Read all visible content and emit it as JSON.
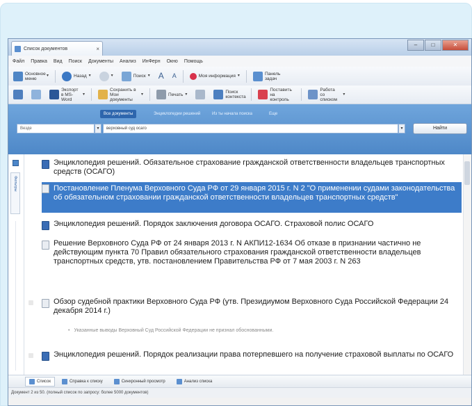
{
  "window": {
    "tab_title": "Список документов",
    "tab_close": "×"
  },
  "menu": [
    "Файл",
    "Правка",
    "Вид",
    "Поиск",
    "Документы",
    "Анализ",
    "ИнФерн",
    "Окно",
    "Помощь"
  ],
  "toolbar1": {
    "main_menu": "Основное меню",
    "back": "Назад",
    "search": "Поиск",
    "my_info": "Моя информация",
    "task_panel": "Панель задач"
  },
  "toolbar2": {
    "export_word": "Экспорт в MS-Word",
    "save_to_my_docs": "Сохранить в Мои документы",
    "print": "Печать",
    "context_search": "Поиск контекста",
    "set_control": "Поставить на контроль",
    "work_with_lists": "Работа со списком"
  },
  "search_panel": {
    "tabs": [
      "Все документы",
      "Энциклопедии решений",
      "Из ты начала поиска",
      "Еще"
    ],
    "scope_value": "Везде",
    "query_value": "верховный суд осаго",
    "find_button": "Найти"
  },
  "left_strip": {
    "tab_label": "Фильтры"
  },
  "results": [
    {
      "icon": "encyclopedia-icon",
      "text": "Энциклопедия решений. Обязательное страхование гражданской ответственности владельцев транспортных средств (ОСАГО)",
      "selected": false
    },
    {
      "icon": "document-icon",
      "text": "Постановление Пленума Верховного Суда РФ от 29 января 2015 г. N 2 \"О применении судами законодательства об обязательном страховании гражданской ответственности владельцев транспортных средств\"",
      "selected": true
    },
    {
      "icon": "encyclopedia-icon",
      "text": "Энциклопедия решений. Порядок заключения договора ОСАГО. Страховой полис ОСАГО",
      "selected": false
    },
    {
      "icon": "document-icon",
      "text": "Решение Верховного Суда РФ от 24 января 2013 г. N АКПИ12-1634 Об отказе в признании частично не действующим пункта 70 Правил обязательного страхования гражданской ответственности владельцев транспортных средств, утв. постановлением Правительства РФ от 7 мая 2003 г. N 263",
      "selected": false
    },
    {
      "icon": "document-icon",
      "text": "Обзор судебной практики Верховного Суда РФ (утв. Президиумом Верховного Суда Российской Федерации 24 декабря 2014 г.)",
      "selected": false
    },
    {
      "icon": "encyclopedia-icon",
      "text": "Энциклопедия решений. Порядок реализации права потерпевшего на получение страховой выплаты по ОСАГО",
      "selected": false
    }
  ],
  "subnote": "Указанные выводы Верховный Суд Российской Федерации не признал обоснованными.",
  "bottom_tabs": [
    "Список",
    "Справка к списку",
    "Синхронный просмотр",
    "Анализ списка"
  ],
  "status": "Документ 2 из 50. (полный список по запросу: более 5000 документов)",
  "colors": {
    "panel_blue": "#4e88c8",
    "selection_blue": "#3d7cc9",
    "card_bg": "#def1fa"
  }
}
